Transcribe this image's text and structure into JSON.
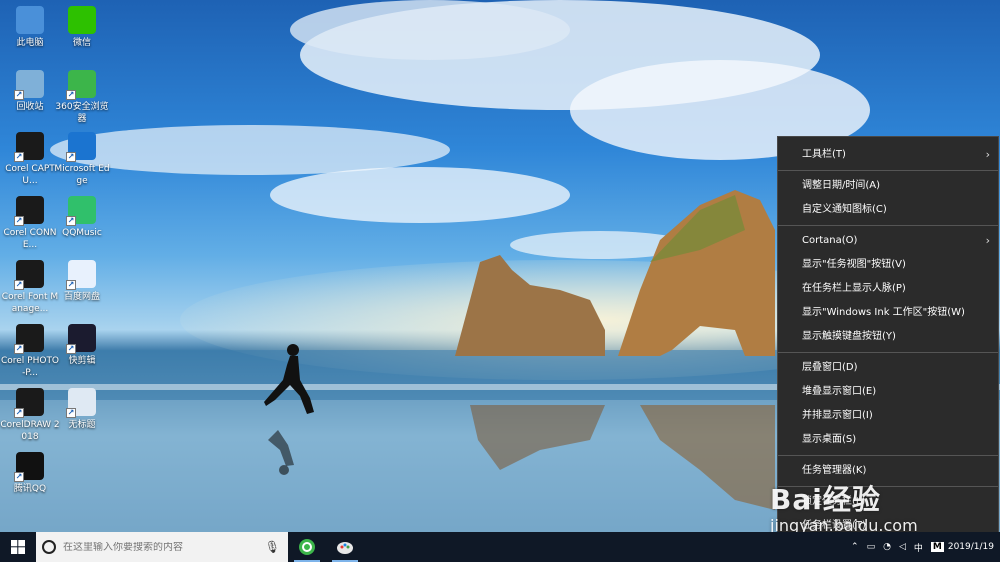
{
  "desktop": {
    "icons": [
      {
        "label": "此电脑",
        "icon": "computer-icon",
        "color": "#4a90d9"
      },
      {
        "label": "微信",
        "icon": "wechat-icon",
        "color": "#2dc100"
      },
      {
        "label": "回收站",
        "icon": "recycle-bin-icon",
        "color": "#7fb0d8"
      },
      {
        "label": "360安全浏览器",
        "icon": "360-browser-icon",
        "color": "#3cb54a"
      },
      {
        "label": "Corel CAPTU...",
        "icon": "corel-capture-icon",
        "color": "#1a1a1a"
      },
      {
        "label": "Microsoft Edge",
        "icon": "edge-icon",
        "color": "#1b74d0"
      },
      {
        "label": "Corel CONNE...",
        "icon": "corel-connect-icon",
        "color": "#1a1a1a"
      },
      {
        "label": "QQMusic",
        "icon": "qqmusic-icon",
        "color": "#30c06b"
      },
      {
        "label": "Corel Font Manage...",
        "icon": "corel-font-manager-icon",
        "color": "#1a1a1a"
      },
      {
        "label": "百度网盘",
        "icon": "baidu-netdisk-icon",
        "color": "#e8f1fd"
      },
      {
        "label": "Corel PHOTO-P...",
        "icon": "corel-photo-paint-icon",
        "color": "#1a1a1a"
      },
      {
        "label": "快剪辑",
        "icon": "kuaijianji-icon",
        "color": "#1b1b2f"
      },
      {
        "label": "CorelDRAW 2018",
        "icon": "coreldraw-icon",
        "color": "#1a1a1a"
      },
      {
        "label": "无标题",
        "icon": "blank-file-icon",
        "color": "#dfe9f3"
      },
      {
        "label": "腾讯QQ",
        "icon": "qq-icon",
        "color": "#111111"
      }
    ]
  },
  "context_menu": {
    "items": [
      {
        "label": "工具栏(T)",
        "submenu": true
      },
      {
        "sep": true
      },
      {
        "label": "调整日期/时间(A)"
      },
      {
        "label": "自定义通知图标(C)"
      },
      {
        "sep": true
      },
      {
        "label": "Cortana(O)",
        "submenu": true
      },
      {
        "label": "显示\"任务视图\"按钮(V)"
      },
      {
        "label": "在任务栏上显示人脉(P)"
      },
      {
        "label": "显示\"Windows Ink 工作区\"按钮(W)"
      },
      {
        "label": "显示触摸键盘按钮(Y)"
      },
      {
        "sep": true
      },
      {
        "label": "层叠窗口(D)"
      },
      {
        "label": "堆叠显示窗口(E)"
      },
      {
        "label": "并排显示窗口(I)"
      },
      {
        "label": "显示桌面(S)"
      },
      {
        "sep": true
      },
      {
        "label": "任务管理器(K)"
      },
      {
        "sep": true
      },
      {
        "label": "锁定任务栏(L)"
      },
      {
        "label": "任务栏设置(T)"
      }
    ],
    "submenu_arrow": "›"
  },
  "watermark": {
    "brand": "Bai经验",
    "url": "jingyan.baidu.com"
  },
  "taskbar": {
    "search_placeholder": "在这里输入你要搜索的内容",
    "tray_ime": "中",
    "tray_m": "M",
    "date": "2019/1/19",
    "accent": "#0f1826"
  }
}
